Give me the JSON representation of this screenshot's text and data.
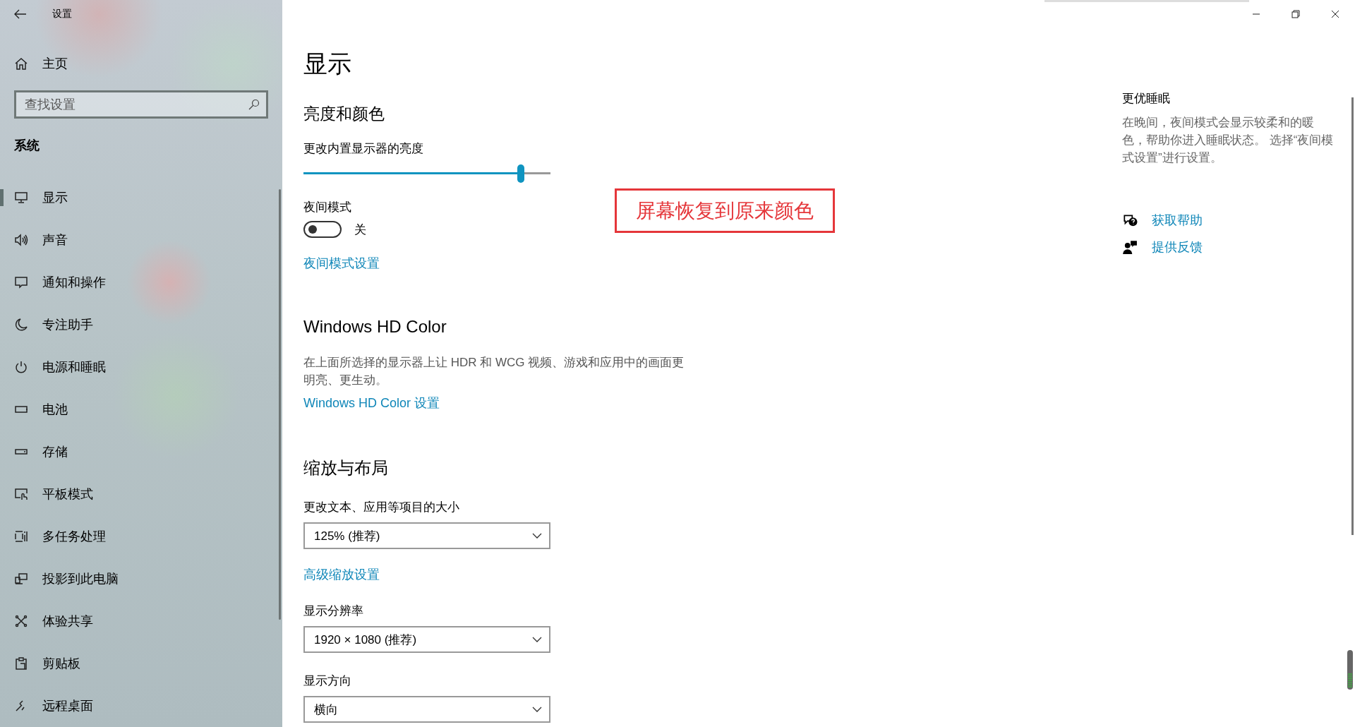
{
  "window": {
    "title": "设置"
  },
  "sidebar": {
    "home": "主页",
    "search": {
      "placeholder": "查找设置"
    },
    "section": "系统",
    "items": [
      {
        "label": "显示",
        "selected": true
      },
      {
        "label": "声音",
        "selected": false
      },
      {
        "label": "通知和操作",
        "selected": false
      },
      {
        "label": "专注助手",
        "selected": false
      },
      {
        "label": "电源和睡眠",
        "selected": false
      },
      {
        "label": "电池",
        "selected": false
      },
      {
        "label": "存储",
        "selected": false
      },
      {
        "label": "平板模式",
        "selected": false
      },
      {
        "label": "多任务处理",
        "selected": false
      },
      {
        "label": "投影到此电脑",
        "selected": false
      },
      {
        "label": "体验共享",
        "selected": false
      },
      {
        "label": "剪贴板",
        "selected": false
      },
      {
        "label": "远程桌面",
        "selected": false
      }
    ]
  },
  "main": {
    "title": "显示",
    "brightness": {
      "heading": "亮度和颜色",
      "label": "更改内置显示器的亮度",
      "level": 0.88
    },
    "night_light": {
      "label": "夜间模式",
      "on": false,
      "state_text": "关",
      "link": "夜间模式设置"
    },
    "hdr": {
      "heading": "Windows HD Color",
      "description": "在上面所选择的显示器上让 HDR 和 WCG 视频、游戏和应用中的画面更明亮、更生动。",
      "link": "Windows HD Color 设置"
    },
    "scale": {
      "heading": "缩放与布局",
      "size_label": "更改文本、应用等项目的大小",
      "size_value": "125% (推荐)",
      "advanced_link": "高级缩放设置",
      "resolution_label": "显示分辨率",
      "resolution_value": "1920 × 1080 (推荐)",
      "orientation_label": "显示方向",
      "orientation_value": "横向"
    }
  },
  "annotation": "屏幕恢复到原来颜色",
  "aside": {
    "heading": "更优睡眠",
    "text": "在晚间，夜间模式会显示较柔和的暖色，帮助你进入睡眠状态。 选择“夜间模式设置”进行设置。",
    "links": [
      {
        "label": "获取帮助"
      },
      {
        "label": "提供反馈"
      }
    ]
  }
}
